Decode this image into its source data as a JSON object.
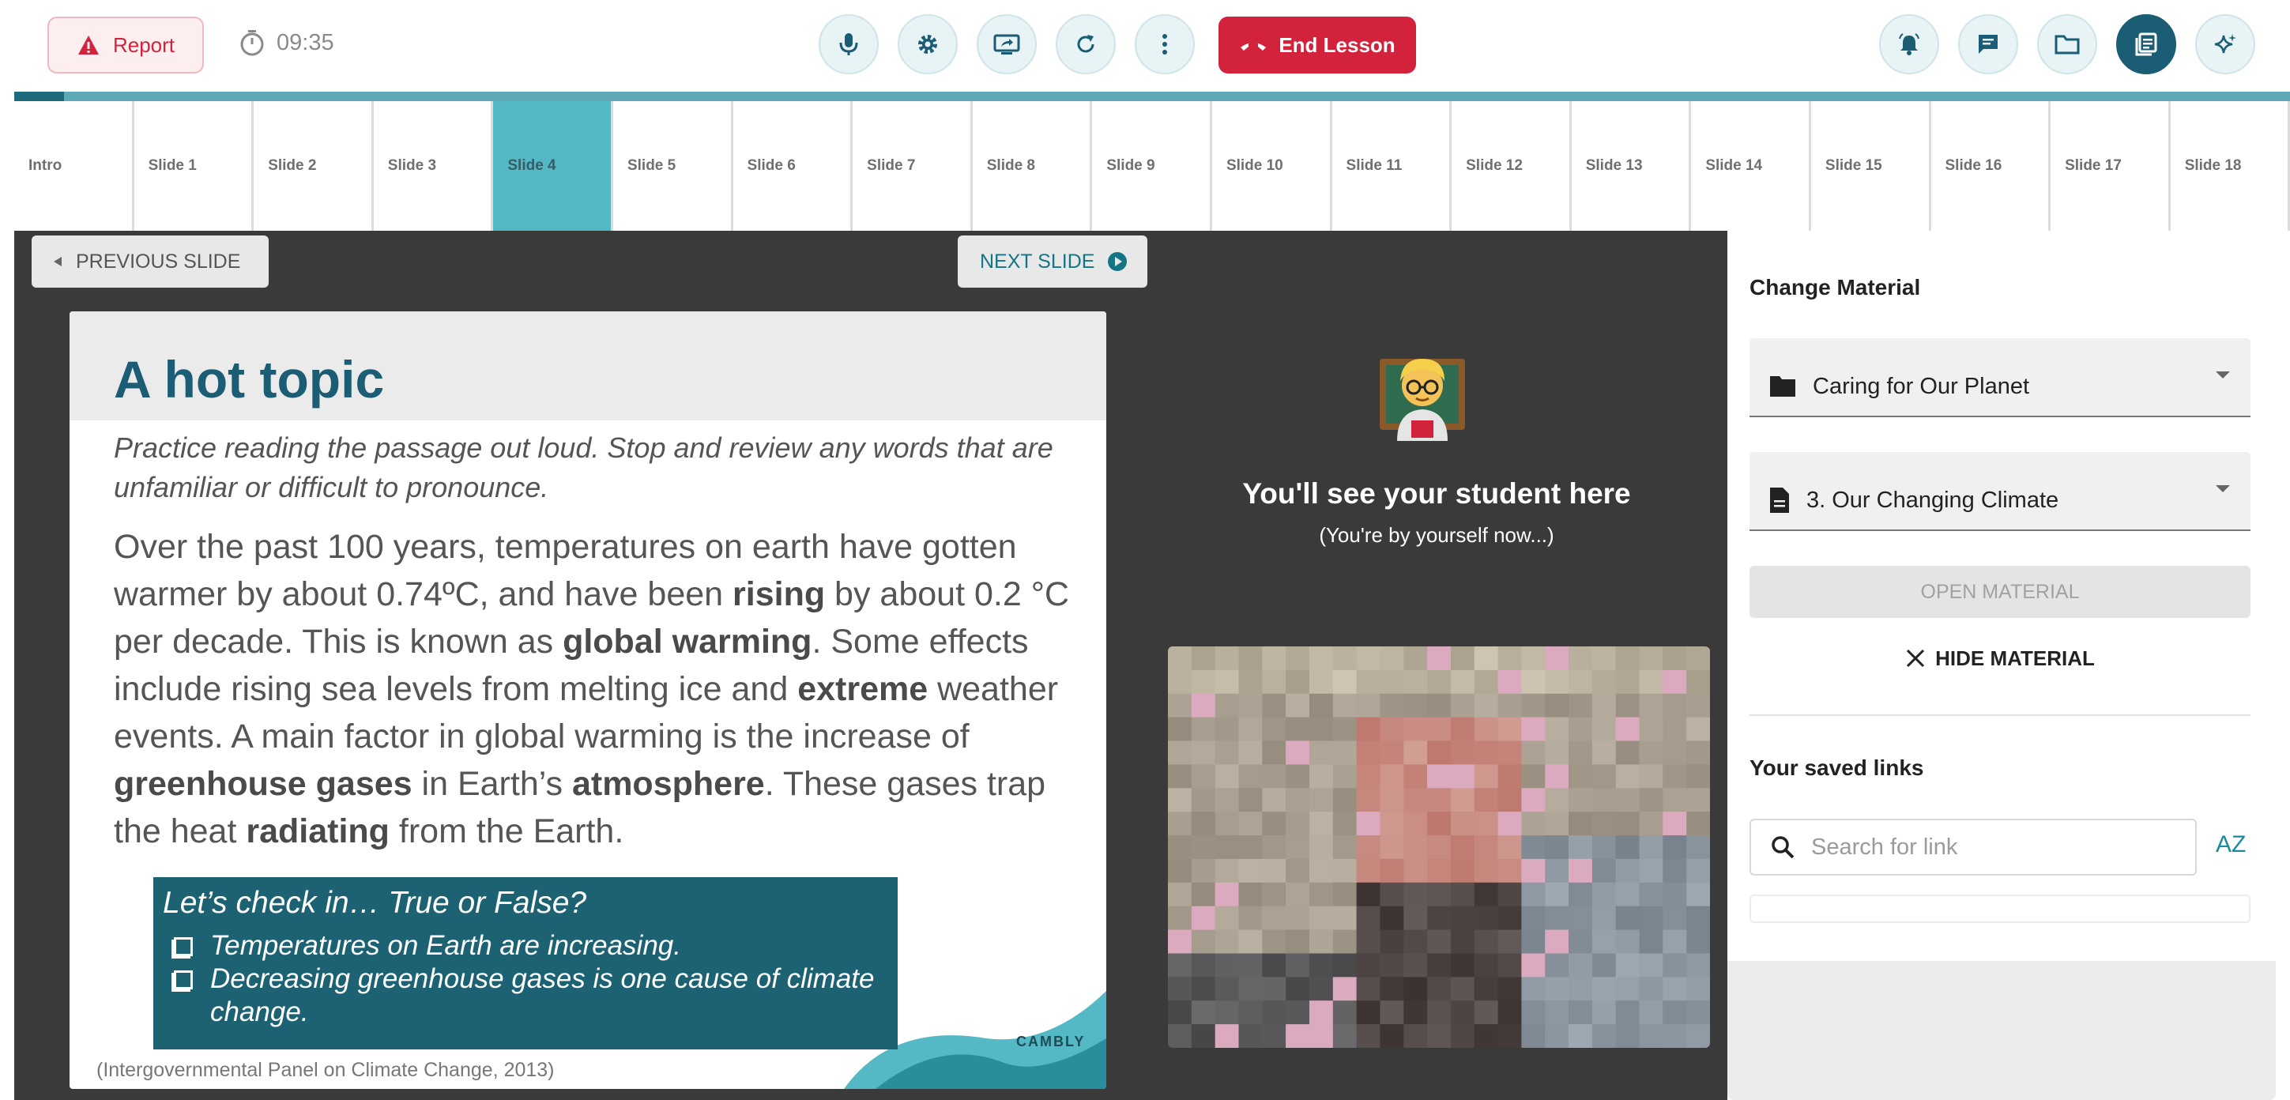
{
  "topbar": {
    "report_label": "Report",
    "timer": "09:35",
    "end_lesson_label": "End Lesson"
  },
  "progress": {
    "fraction": 0.022
  },
  "tabs": [
    "Intro",
    "Slide 1",
    "Slide 2",
    "Slide 3",
    "Slide 4",
    "Slide 5",
    "Slide 6",
    "Slide 7",
    "Slide 8",
    "Slide 9",
    "Slide 10",
    "Slide 11",
    "Slide 12",
    "Slide 13",
    "Slide 14",
    "Slide 15",
    "Slide 16",
    "Slide 17",
    "Slide 18"
  ],
  "active_tab": "Slide 4",
  "nav": {
    "prev_label": "PREVIOUS SLIDE",
    "next_label": "NEXT SLIDE"
  },
  "slide": {
    "title": "A hot topic",
    "instructions": "Practice reading the passage out loud. Stop and review any words that are unfamiliar or difficult to pronounce.",
    "body": [
      {
        "t": "Over the past 100 years, temperatures on earth have gotten warmer by about 0.74ºC, and have been "
      },
      {
        "t": "rising",
        "b": true
      },
      {
        "t": " by about 0.2 °C per decade. This is known as "
      },
      {
        "t": "global warming",
        "b": true
      },
      {
        "t": ". Some effects include rising sea levels from melting ice and "
      },
      {
        "t": "extreme",
        "b": true
      },
      {
        "t": " weather events. A main factor in global warming is the increase of "
      },
      {
        "t": "greenhouse gases",
        "b": true
      },
      {
        "t": " in Earth’s "
      },
      {
        "t": "atmosphere",
        "b": true
      },
      {
        "t": ". These gases trap the heat "
      },
      {
        "t": "radiating",
        "b": true
      },
      {
        "t": " from the Earth."
      }
    ],
    "check_title": "Let’s check in… True or False?",
    "check_items": [
      "Temperatures on Earth are increasing.",
      "Decreasing greenhouse gases is one cause of climate change."
    ],
    "source": "(Intergovernmental Panel on Climate Change, 2013)",
    "logo_text": "CAMBLY"
  },
  "student": {
    "title": "You'll see your student here",
    "subtitle": "(You're by yourself now...)"
  },
  "panel": {
    "title": "Change Material",
    "folder_value": "Caring for Our Planet",
    "material_value": "3. Our Changing Climate",
    "open_label": "OPEN MATERIAL",
    "hide_label": "HIDE MATERIAL",
    "links_title": "Your saved links",
    "search_placeholder": "Search for link",
    "sort_label": "AZ"
  },
  "colors": {
    "accent": "#1b5d74",
    "danger": "#d3233c",
    "tab_active": "#54b8c5",
    "stage_bg": "#3a3a3a"
  },
  "icons": [
    "warning-icon",
    "timer-icon",
    "microphone-icon",
    "gear-icon",
    "screen-share-icon",
    "refresh-icon",
    "more-vertical-icon",
    "phone-hangup-icon",
    "notification-bell-icon",
    "chat-icon",
    "folder-icon",
    "material-book-icon",
    "sparkle-icon",
    "play-left-icon",
    "play-circle-icon",
    "file-icon",
    "close-icon",
    "search-icon",
    "sort-az-icon",
    "teacher-emoji-icon"
  ]
}
